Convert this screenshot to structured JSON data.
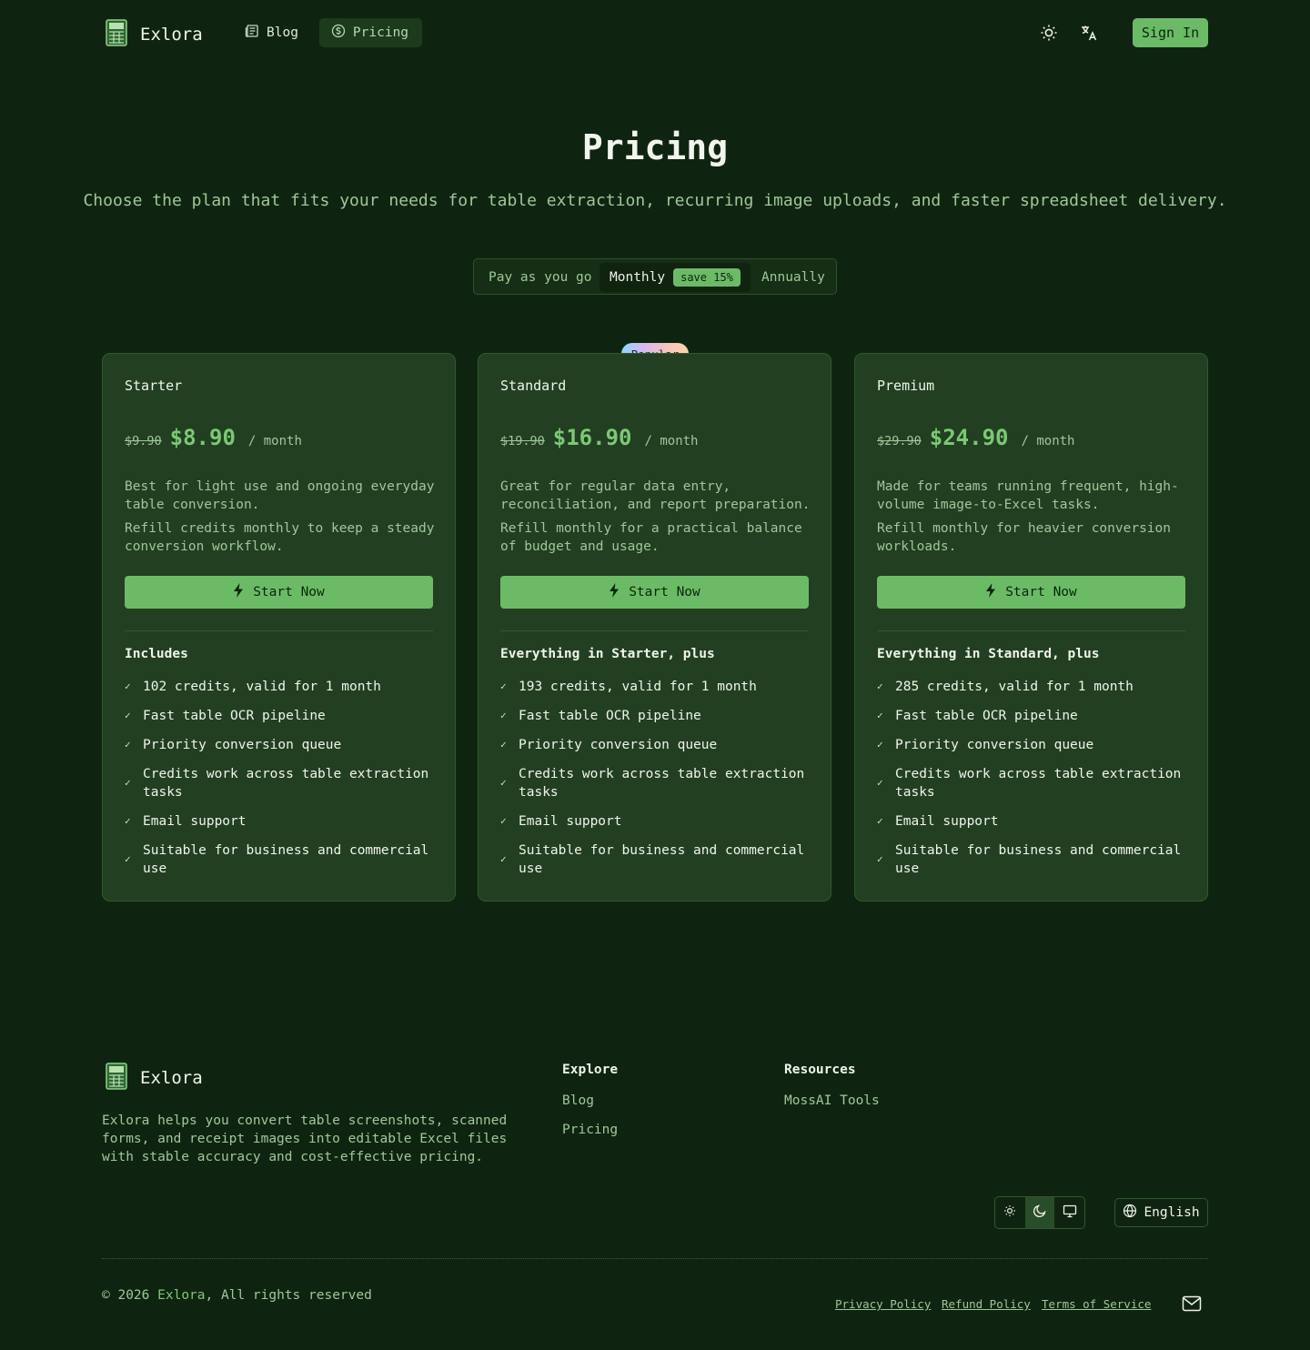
{
  "brand": {
    "name": "Exlora"
  },
  "nav": {
    "items": [
      {
        "label": "Blog",
        "icon": "newspaper-icon",
        "active": false
      },
      {
        "label": "Pricing",
        "icon": "dollar-circle-icon",
        "active": true
      }
    ],
    "sign_in_label": "Sign In"
  },
  "hero": {
    "title": "Pricing",
    "subtitle": "Choose the plan that fits your needs for table extraction, recurring image uploads, and faster spreadsheet delivery."
  },
  "billing_toggle": {
    "options": [
      "Pay as you go",
      "Monthly",
      "Annually"
    ],
    "selected": "Monthly",
    "save_badge": "save 15%"
  },
  "popular_badge": "Popular",
  "plans": [
    {
      "name": "Starter",
      "old_price": "$9.90",
      "price": "$8.90",
      "period": "/ month",
      "desc1": "Best for light use and ongoing everyday table conversion.",
      "desc2": "Refill credits monthly to keep a steady conversion workflow.",
      "cta": "Start Now",
      "includes_title": "Includes",
      "features": [
        "102 credits, valid for 1 month",
        "Fast table OCR pipeline",
        "Priority conversion queue",
        "Credits work across table extraction tasks",
        "Email support",
        "Suitable for business and commercial use"
      ]
    },
    {
      "name": "Standard",
      "old_price": "$19.90",
      "price": "$16.90",
      "period": "/ month",
      "desc1": "Great for regular data entry, reconciliation, and report preparation.",
      "desc2": "Refill monthly for a practical balance of budget and usage.",
      "cta": "Start Now",
      "includes_title": "Everything in Starter, plus",
      "features": [
        "193 credits, valid for 1 month",
        "Fast table OCR pipeline",
        "Priority conversion queue",
        "Credits work across table extraction tasks",
        "Email support",
        "Suitable for business and commercial use"
      ]
    },
    {
      "name": "Premium",
      "old_price": "$29.90",
      "price": "$24.90",
      "period": "/ month",
      "desc1": "Made for teams running frequent, high-volume image-to-Excel tasks.",
      "desc2": "Refill monthly for heavier conversion workloads.",
      "cta": "Start Now",
      "includes_title": "Everything in Standard, plus",
      "features": [
        "285 credits, valid for 1 month",
        "Fast table OCR pipeline",
        "Priority conversion queue",
        "Credits work across table extraction tasks",
        "Email support",
        "Suitable for business and commercial use"
      ]
    }
  ],
  "footer": {
    "description": "Exlora helps you convert table screenshots, scanned forms, and receipt images into editable Excel files with stable accuracy and cost-effective pricing.",
    "explore": {
      "title": "Explore",
      "links": [
        "Blog",
        "Pricing"
      ]
    },
    "resources": {
      "title": "Resources",
      "links": [
        "MossAI Tools"
      ]
    },
    "theme_options": [
      "sun-icon",
      "moon-icon",
      "monitor-icon"
    ],
    "theme_selected": "moon-icon",
    "language": "English",
    "copyright_prefix": "© 2026",
    "copyright_brand": "Exlora",
    "copyright_suffix": ", All rights reserved",
    "legal_links": [
      "Privacy Policy",
      "Refund Policy",
      "Terms of Service"
    ]
  },
  "colors": {
    "background": "#0f2410",
    "card": "#223f22",
    "accent": "#6bbb66",
    "muted_text": "#9fc79a"
  }
}
